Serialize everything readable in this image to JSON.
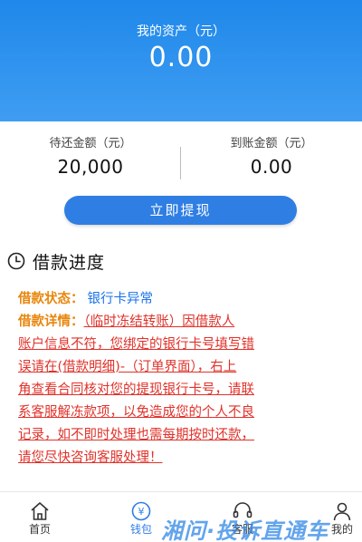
{
  "header": {
    "assets_label": "我的资产（元）",
    "assets_value": "0.00"
  },
  "amounts": {
    "pending_label": "待还金额（元）",
    "pending_value": "20,000",
    "received_label": "到账金额（元）",
    "received_value": "0.00"
  },
  "withdraw_button": "立即提现",
  "progress": {
    "icon": "clock-icon",
    "title": "借款进度",
    "status_label": "借款状态：",
    "status_value": "银行卡异常",
    "detail_label": "借款详情：",
    "detail_lines": [
      "（临时冻结转账）因借款人",
      "账户信息不符，您绑定的银行卡号填写错",
      "误请在(借款明细)-（订单界面），右上",
      "角查看合同核对您的提现银行卡号，请联",
      "系客服解冻款项，以免造成您的个人不良",
      "记录，如不即时处理也需每期按时还款，",
      "请您尽快咨询客服处理！"
    ]
  },
  "tabbar": {
    "items": [
      {
        "label": "首页",
        "icon": "home-icon"
      },
      {
        "label": "钱包",
        "icon": "wallet-icon"
      },
      {
        "label": "客服",
        "icon": "headset-icon"
      },
      {
        "label": "我的",
        "icon": "user-icon"
      }
    ],
    "active_index": 1
  },
  "watermark": "湘问·投诉直通车",
  "colors": {
    "header_blue": "#2a90ee",
    "button_blue": "#2f7ee3",
    "label_orange": "#e8860c",
    "status_blue": "#1a73e8",
    "detail_red": "#e0322a"
  }
}
